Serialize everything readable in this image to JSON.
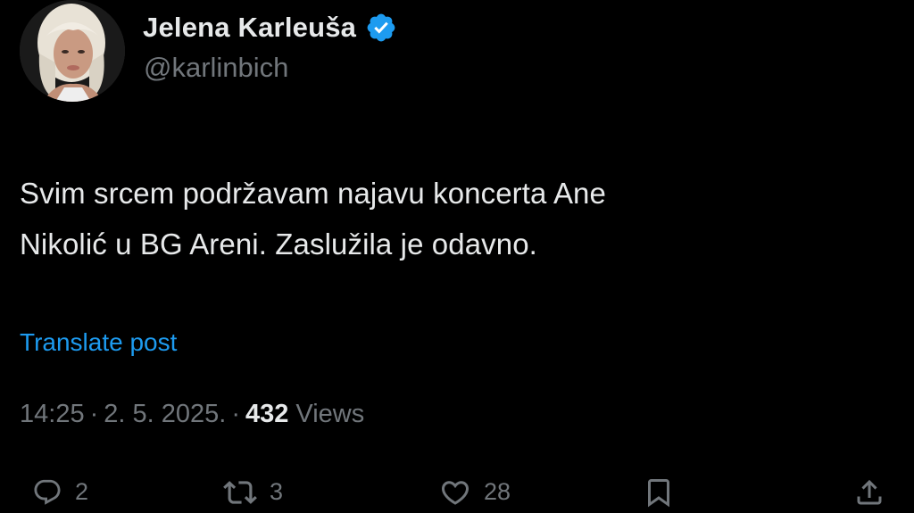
{
  "author": {
    "display_name": "Jelena Karleuša",
    "handle": "@karlinbich",
    "verified": true,
    "verified_color": "#1d9bf0"
  },
  "post": {
    "text_lines": [
      "Svim srcem podržavam najavu koncerta Ane",
      "Nikolić u BG Areni. Zaslužila je odavno."
    ],
    "translate_label": "Translate post",
    "time": "14:25",
    "date": "2. 5. 2025.",
    "separator": "·",
    "views_count": "432",
    "views_label": "Views"
  },
  "actions": {
    "reply": {
      "icon": "reply-icon",
      "count": "2"
    },
    "repost": {
      "icon": "repost-icon",
      "count": "3"
    },
    "like": {
      "icon": "heart-icon",
      "count": "28"
    },
    "bookmark": {
      "icon": "bookmark-icon"
    },
    "share": {
      "icon": "share-icon"
    }
  },
  "colors": {
    "background": "#000000",
    "primary_text": "#e7e9ea",
    "secondary_text": "#71767b",
    "link": "#1d9bf0"
  }
}
